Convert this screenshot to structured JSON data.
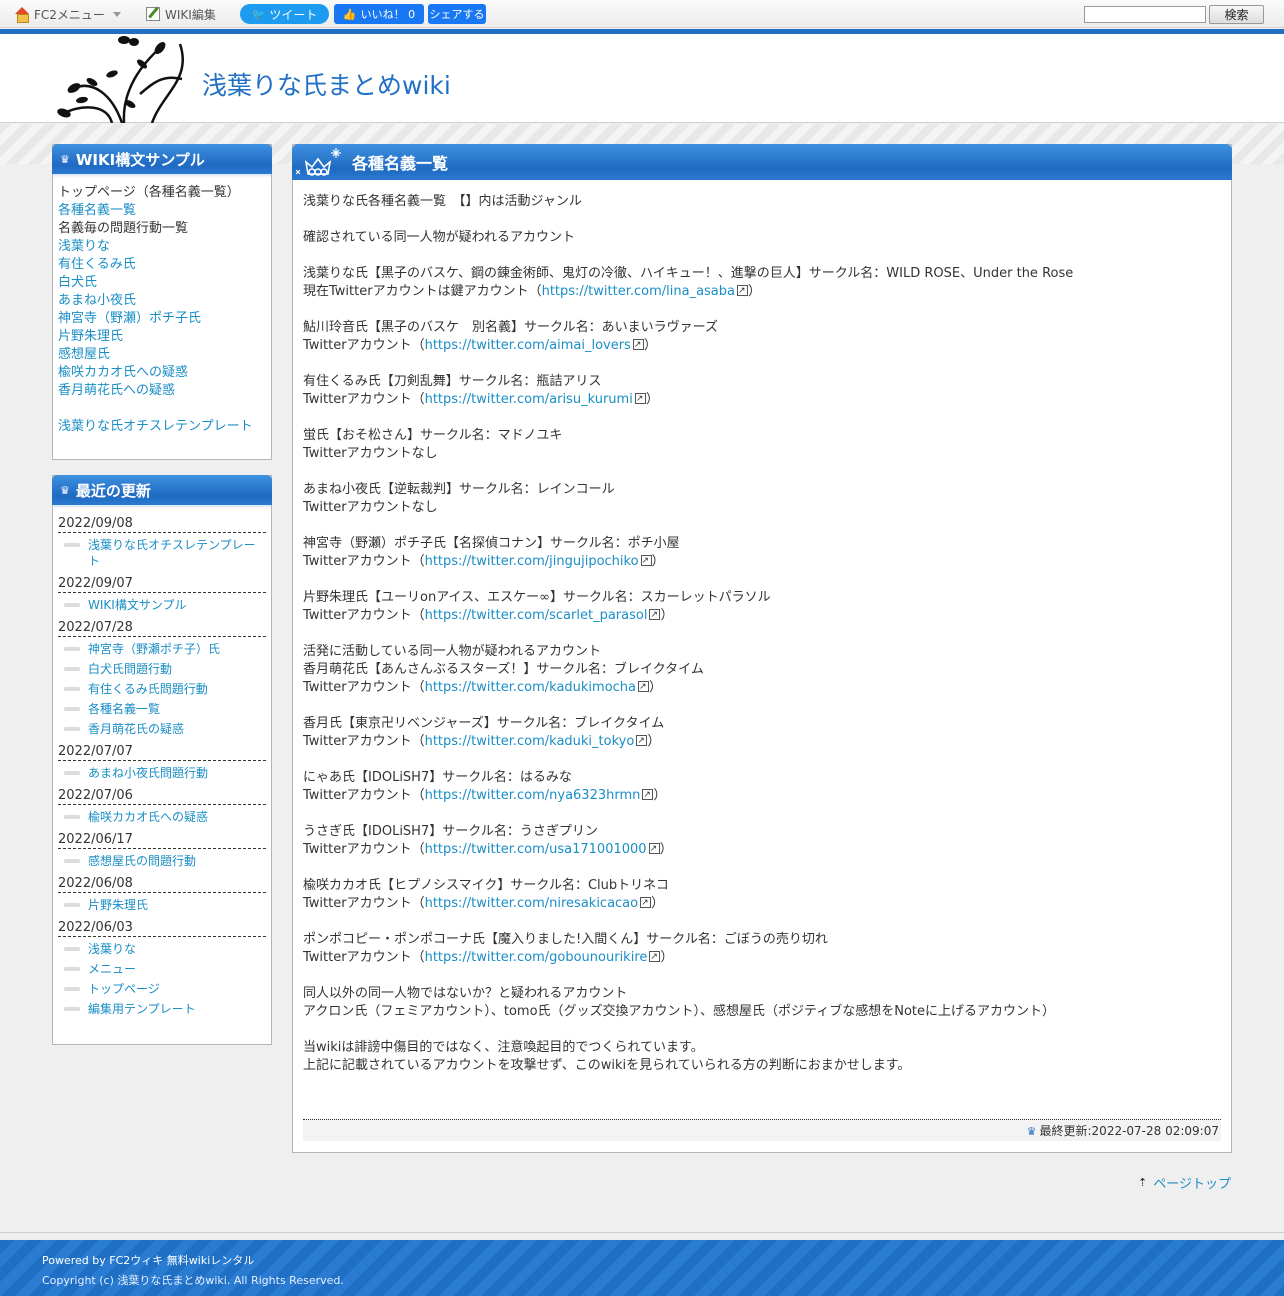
{
  "fc2bar": {
    "menu_label": "FC2メニュー",
    "edit_label": "WIKI編集",
    "tweet_label": "ツイート",
    "like_label": "いいね！ 0",
    "share_label": "シェアする",
    "search_value": "",
    "search_button": "検索"
  },
  "header": {
    "title": "浅葉りな氏まとめwiki"
  },
  "sidebar": {
    "sample_title": "WIKI構文サンプル",
    "nav": [
      {
        "label": "トップページ（各種名義一覧）",
        "link": false
      },
      {
        "label": "各種名義一覧",
        "link": true
      },
      {
        "label": "名義毎の問題行動一覧",
        "link": false
      },
      {
        "label": "浅葉りな",
        "link": true
      },
      {
        "label": "有住くるみ氏",
        "link": true
      },
      {
        "label": "白犬氏",
        "link": true
      },
      {
        "label": "あまね小夜氏",
        "link": true
      },
      {
        "label": "神宮寺（野瀬）ポチ子氏",
        "link": true
      },
      {
        "label": "片野朱理氏",
        "link": true
      },
      {
        "label": "感想屋氏",
        "link": true
      },
      {
        "label": "楡咲カカオ氏への疑惑",
        "link": true
      },
      {
        "label": "香月萌花氏への疑惑",
        "link": true
      },
      {
        "label": "",
        "link": false
      },
      {
        "label": "浅葉りな氏オチスレテンプレート",
        "link": true
      }
    ],
    "recent_title": "最近の更新",
    "recent": [
      {
        "date": "2022/09/08",
        "items": [
          "浅葉りな氏オチスレテンプレート"
        ]
      },
      {
        "date": "2022/09/07",
        "items": [
          "WIKI構文サンプル"
        ]
      },
      {
        "date": "2022/07/28",
        "items": [
          "神宮寺（野瀬ポチ子）氏",
          "白犬氏問題行動",
          "有住くるみ氏問題行動",
          "各種名義一覧",
          "香月萌花氏の疑惑"
        ]
      },
      {
        "date": "2022/07/07",
        "items": [
          "あまね小夜氏問題行動"
        ]
      },
      {
        "date": "2022/07/06",
        "items": [
          "楡咲カカオ氏への疑惑"
        ]
      },
      {
        "date": "2022/06/17",
        "items": [
          "感想屋氏の問題行動"
        ]
      },
      {
        "date": "2022/06/08",
        "items": [
          "片野朱理氏"
        ]
      },
      {
        "date": "2022/06/03",
        "items": [
          "浅葉りな",
          "メニュー",
          "トップページ",
          "編集用テンプレート"
        ]
      }
    ]
  },
  "main": {
    "title": "各種名義一覧",
    "lines": [
      {
        "t": "浅葉りな氏各種名義一覧　【】内は活動ジャンル"
      },
      {
        "t": ""
      },
      {
        "t": "確認されている同一人物が疑われるアカウント"
      },
      {
        "t": ""
      },
      {
        "t": "浅葉りな氏【黒子のバスケ、鋼の錬金術師、鬼灯の冷徹、ハイキュー！、進撃の巨人】サークル名：WILD ROSE、Under the Rose"
      },
      {
        "pre": "現在Twitterアカウントは鍵アカウント（",
        "link": "https://twitter.com/lina_asaba",
        "post": "）"
      },
      {
        "t": ""
      },
      {
        "t": "鮎川玲音氏【黒子のバスケ　別名義】サークル名：あいまいラヴァーズ"
      },
      {
        "pre": "Twitterアカウント（",
        "link": "https://twitter.com/aimai_lovers",
        "post": "）"
      },
      {
        "t": ""
      },
      {
        "t": "有住くるみ氏【刀剣乱舞】サークル名：瓶詰アリス"
      },
      {
        "pre": "Twitterアカウント（",
        "link": "https://twitter.com/arisu_kurumi",
        "post": "）"
      },
      {
        "t": ""
      },
      {
        "t": "蛍氏【おそ松さん】サークル名：マドノユキ"
      },
      {
        "t": "Twitterアカウントなし"
      },
      {
        "t": ""
      },
      {
        "t": "あまね小夜氏【逆転裁判】サークル名：レインコール"
      },
      {
        "t": "Twitterアカウントなし"
      },
      {
        "t": ""
      },
      {
        "t": "神宮寺（野瀬）ポチ子氏【名探偵コナン】サークル名：ポチ小屋"
      },
      {
        "pre": "Twitterアカウント（",
        "link": "https://twitter.com/jingujipochiko",
        "post": "）"
      },
      {
        "t": ""
      },
      {
        "t": "片野朱理氏【ユーリonアイス、エスケー∞】サークル名：スカーレットパラソル"
      },
      {
        "pre": "Twitterアカウント（",
        "link": "https://twitter.com/scarlet_parasol",
        "post": "）"
      },
      {
        "t": ""
      },
      {
        "t": "活発に活動している同一人物が疑われるアカウント"
      },
      {
        "t": "香月萌花氏【あんさんぶるスターズ！】サークル名：ブレイクタイム"
      },
      {
        "pre": "Twitterアカウント（",
        "link": "https://twitter.com/kadukimocha",
        "post": "）"
      },
      {
        "t": ""
      },
      {
        "t": "香月氏【東京卍リベンジャーズ】サークル名：ブレイクタイム"
      },
      {
        "pre": "Twitterアカウント（",
        "link": "https://twitter.com/kaduki_tokyo",
        "post": "）"
      },
      {
        "t": ""
      },
      {
        "t": "にゃあ氏【IDOLiSH7】サークル名：はるみな"
      },
      {
        "pre": "Twitterアカウント（",
        "link": "https://twitter.com/nya6323hrmn",
        "post": "）"
      },
      {
        "t": ""
      },
      {
        "t": "うさぎ氏【IDOLiSH7】サークル名：うさぎプリン"
      },
      {
        "pre": "Twitterアカウント（",
        "link": "https://twitter.com/usa171001000",
        "post": "）"
      },
      {
        "t": ""
      },
      {
        "t": "楡咲カカオ氏【ヒプノシスマイク】サークル名：Clubトリネコ"
      },
      {
        "pre": "Twitterアカウント（",
        "link": "https://twitter.com/niresakicacao",
        "post": "）"
      },
      {
        "t": ""
      },
      {
        "t": "ポンポコピー・ポンポコーナ氏【魔入りました!入間くん】サークル名：ごぼうの売り切れ"
      },
      {
        "pre": "Twitterアカウント（",
        "link": "https://twitter.com/gobounourikire",
        "post": "）"
      },
      {
        "t": ""
      },
      {
        "t": "同人以外の同一人物ではないか？と疑われるアカウント"
      },
      {
        "t": "アクロン氏（フェミアカウント）、tomo氏（グッズ交換アカウント）、感想屋氏（ポジティブな感想をNoteに上げるアカウント）"
      },
      {
        "t": ""
      },
      {
        "t": "当wikiは誹謗中傷目的ではなく、注意喚起目的でつくられています。"
      },
      {
        "t": "上記に記載されているアカウントを攻撃せず、このwikiを見られていられる方の判断におまかせします。"
      }
    ],
    "last_updated": "最終更新:2022-07-28 02:09:07"
  },
  "pagetop": "ページトップ",
  "footer": {
    "powered_prefix": "Powered by",
    "powered_link1": "FC2ウィキ",
    "powered_link2": "無料wikiレンタル",
    "copyright": "Copyright (c) 浅葉りな氏まとめwiki. All Rights Reserved."
  }
}
